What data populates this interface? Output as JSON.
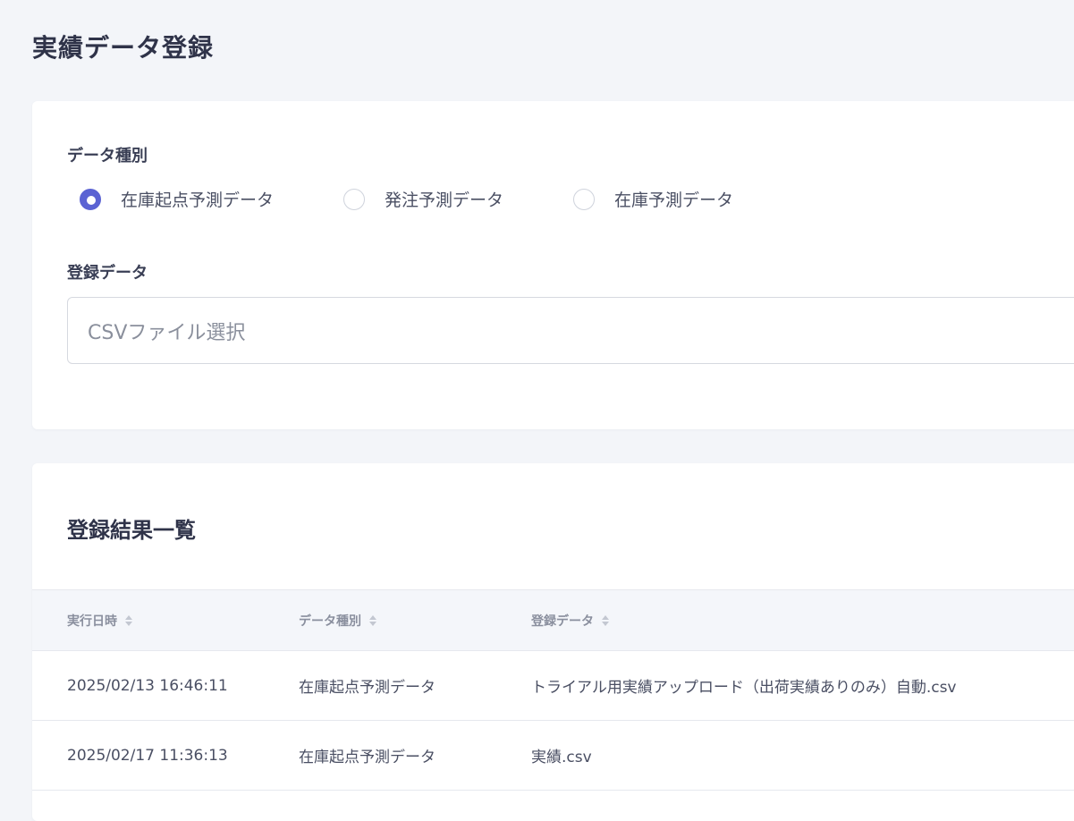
{
  "page": {
    "title": "実績データ登録"
  },
  "form": {
    "data_type_label": "データ種別",
    "radio_options": [
      {
        "label": "在庫起点予測データ",
        "checked": true
      },
      {
        "label": "発注予測データ",
        "checked": false
      },
      {
        "label": "在庫予測データ",
        "checked": false
      }
    ],
    "upload_label": "登録データ",
    "file_placeholder": "CSVファイル選択"
  },
  "results": {
    "title": "登録結果一覧",
    "columns": [
      "実行日時",
      "データ種別",
      "登録データ"
    ],
    "rows": [
      {
        "datetime": "2025/02/13 16:46:11",
        "type": "在庫起点予測データ",
        "file": "トライアル用実績アップロード（出荷実績ありのみ）自動.csv"
      },
      {
        "datetime": "2025/02/17 11:36:13",
        "type": "在庫起点予測データ",
        "file": "実績.csv"
      }
    ]
  },
  "colors": {
    "accent": "#5b63d3",
    "background": "#f3f5f9"
  },
  "icons": {
    "sort": "sort-updown-icon"
  }
}
